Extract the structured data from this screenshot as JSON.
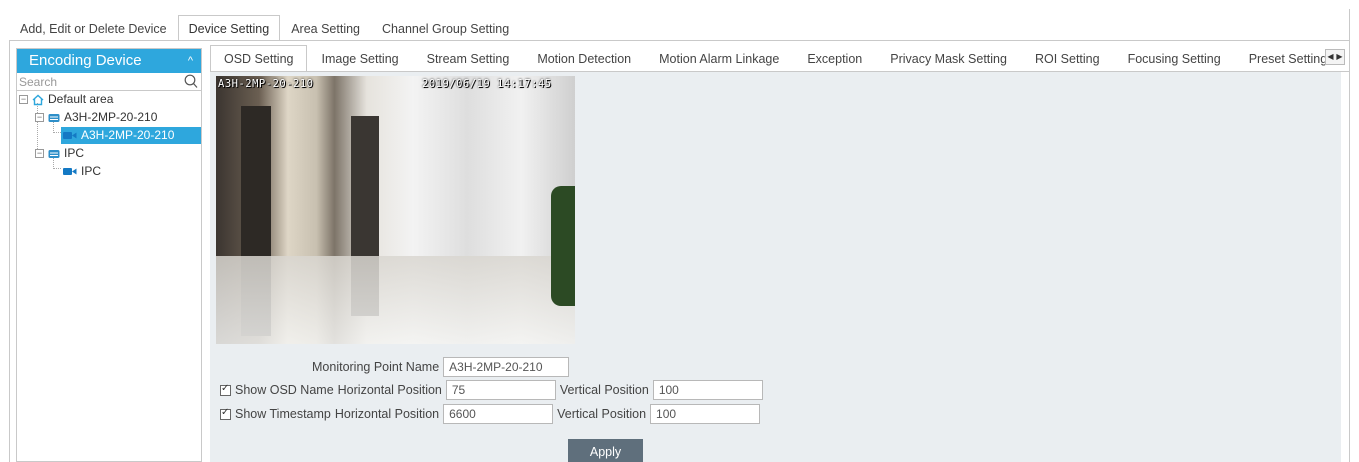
{
  "top_tabs": [
    {
      "label": "Add, Edit or Delete Device"
    },
    {
      "label": "Device Setting"
    },
    {
      "label": "Area Setting"
    },
    {
      "label": "Channel Group Setting"
    }
  ],
  "sidebar": {
    "title": "Encoding Device",
    "search_placeholder": "Search",
    "tree": {
      "root": "Default area",
      "device1": "A3H-2MP-20-210",
      "channel1": "A3H-2MP-20-210",
      "device2": "IPC",
      "channel2": "IPC"
    }
  },
  "sub_tabs": [
    {
      "label": "OSD Setting"
    },
    {
      "label": "Image Setting"
    },
    {
      "label": "Stream Setting"
    },
    {
      "label": "Motion Detection"
    },
    {
      "label": "Motion Alarm Linkage"
    },
    {
      "label": "Exception"
    },
    {
      "label": "Privacy Mask Setting"
    },
    {
      "label": "ROI Setting"
    },
    {
      "label": "Focusing Setting"
    },
    {
      "label": "Preset Setting"
    }
  ],
  "video": {
    "osd_name": "A3H-2MP-20-210",
    "osd_timestamp": "2019/06/19 14:17:45"
  },
  "form": {
    "monitoring_point_label": "Monitoring Point Name",
    "monitoring_point_value": "A3H-2MP-20-210",
    "show_osd_label": "Show OSD Name",
    "show_osd_checked": true,
    "show_timestamp_label": "Show Timestamp",
    "show_timestamp_checked": true,
    "horizontal_label": "Horizontal Position",
    "vertical_label": "Vertical Position",
    "osd_h": "75",
    "osd_v": "100",
    "ts_h": "6600",
    "ts_v": "100",
    "apply_label": "Apply"
  },
  "colors": {
    "accent": "#2ea7dd",
    "content_bg": "#eaeef1",
    "button": "#5f6f7c"
  }
}
